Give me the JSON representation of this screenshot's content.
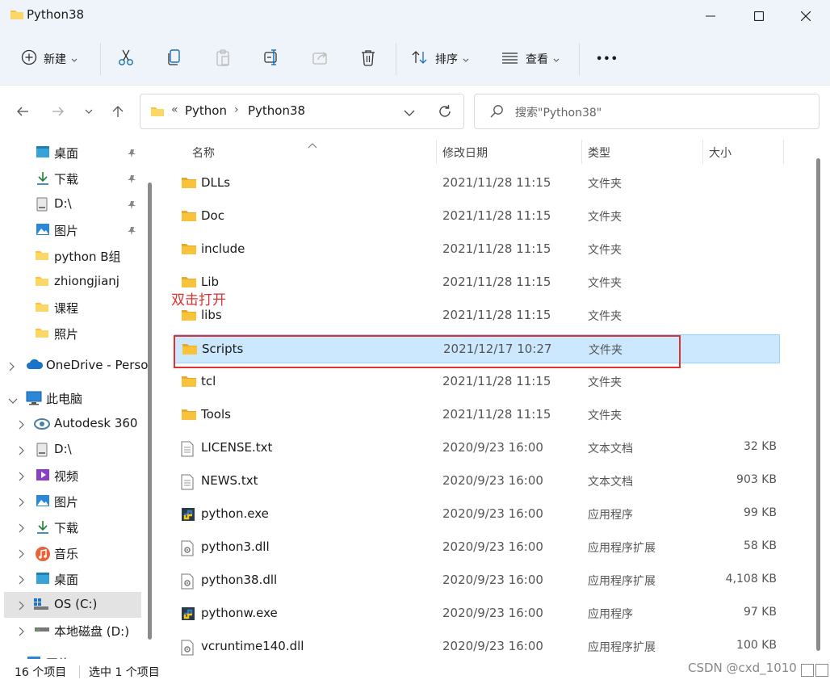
{
  "window": {
    "title": "Python38",
    "controls": {
      "minimize": "–",
      "maximize": "☐",
      "close": "✕"
    }
  },
  "toolbar": {
    "new_label": "新建",
    "sort_label": "排序",
    "view_label": "查看",
    "more_label": "•••"
  },
  "address": {
    "overflow": "«",
    "segments": [
      "Python",
      "Python38"
    ],
    "separator": "›"
  },
  "search": {
    "placeholder": "搜索\"Python38\""
  },
  "sidebar": {
    "items": [
      {
        "label": "桌面",
        "icon": "desktop-icon",
        "pinned": true
      },
      {
        "label": "下载",
        "icon": "download-icon",
        "pinned": true
      },
      {
        "label": "D:\\",
        "icon": "drive-icon",
        "pinned": true
      },
      {
        "label": "图片",
        "icon": "pictures-icon",
        "pinned": true
      },
      {
        "label": "python B组",
        "icon": "folder-icon"
      },
      {
        "label": "zhiongjianj",
        "icon": "folder-icon"
      },
      {
        "label": "课程",
        "icon": "folder-icon"
      },
      {
        "label": "照片",
        "icon": "folder-icon"
      },
      {
        "label": "OneDrive - Perso",
        "icon": "onedrive-icon"
      },
      {
        "label": "此电脑",
        "icon": "this-pc-icon"
      },
      {
        "label": "Autodesk 360",
        "icon": "autodesk-icon"
      },
      {
        "label": "D:\\",
        "icon": "drive-icon"
      },
      {
        "label": "视频",
        "icon": "videos-icon"
      },
      {
        "label": "图片",
        "icon": "pictures-icon"
      },
      {
        "label": "下载",
        "icon": "download-icon"
      },
      {
        "label": "音乐",
        "icon": "music-icon"
      },
      {
        "label": "桌面",
        "icon": "desktop-icon"
      },
      {
        "label": "OS (C:)",
        "icon": "os-drive-icon"
      },
      {
        "label": "本地磁盘 (D:)",
        "icon": "local-disk-icon"
      },
      {
        "label": "网络",
        "icon": "network-icon"
      }
    ]
  },
  "columns": {
    "name": "名称",
    "date": "修改日期",
    "type": "类型",
    "size": "大小"
  },
  "files": [
    {
      "name": "DLLs",
      "date": "2021/11/28 11:15",
      "type": "文件夹",
      "size": "",
      "icon": "folder-icon"
    },
    {
      "name": "Doc",
      "date": "2021/11/28 11:15",
      "type": "文件夹",
      "size": "",
      "icon": "folder-icon"
    },
    {
      "name": "include",
      "date": "2021/11/28 11:15",
      "type": "文件夹",
      "size": "",
      "icon": "folder-icon"
    },
    {
      "name": "Lib",
      "date": "2021/11/28 11:15",
      "type": "文件夹",
      "size": "",
      "icon": "folder-icon"
    },
    {
      "name": "libs",
      "date": "2021/11/28 11:15",
      "type": "文件夹",
      "size": "",
      "icon": "folder-icon"
    },
    {
      "name": "Scripts",
      "date": "2021/12/17 10:27",
      "type": "文件夹",
      "size": "",
      "icon": "folder-icon",
      "selected": true
    },
    {
      "name": "tcl",
      "date": "2021/11/28 11:15",
      "type": "文件夹",
      "size": "",
      "icon": "folder-icon"
    },
    {
      "name": "Tools",
      "date": "2021/11/28 11:15",
      "type": "文件夹",
      "size": "",
      "icon": "folder-icon"
    },
    {
      "name": "LICENSE.txt",
      "date": "2020/9/23 16:00",
      "type": "文本文档",
      "size": "32 KB",
      "icon": "text-file-icon"
    },
    {
      "name": "NEWS.txt",
      "date": "2020/9/23 16:00",
      "type": "文本文档",
      "size": "903 KB",
      "icon": "text-file-icon"
    },
    {
      "name": "python.exe",
      "date": "2020/9/23 16:00",
      "type": "应用程序",
      "size": "99 KB",
      "icon": "python-exe-icon"
    },
    {
      "name": "python3.dll",
      "date": "2020/9/23 16:00",
      "type": "应用程序扩展",
      "size": "58 KB",
      "icon": "dll-file-icon"
    },
    {
      "name": "python38.dll",
      "date": "2020/9/23 16:00",
      "type": "应用程序扩展",
      "size": "4,108 KB",
      "icon": "dll-file-icon"
    },
    {
      "name": "pythonw.exe",
      "date": "2020/9/23 16:00",
      "type": "应用程序",
      "size": "97 KB",
      "icon": "python-exe-icon"
    },
    {
      "name": "vcruntime140.dll",
      "date": "2020/9/23 16:00",
      "type": "应用程序扩展",
      "size": "100 KB",
      "icon": "dll-file-icon"
    }
  ],
  "annotation": {
    "text": "双击打开"
  },
  "status": {
    "count": "16 个项目",
    "selected": "选中 1 个项目"
  },
  "watermark": "CSDN @cxd_1010",
  "colors": {
    "selection": "#cce8ff",
    "annotation": "#e03131",
    "folder": "#f8c33b"
  }
}
